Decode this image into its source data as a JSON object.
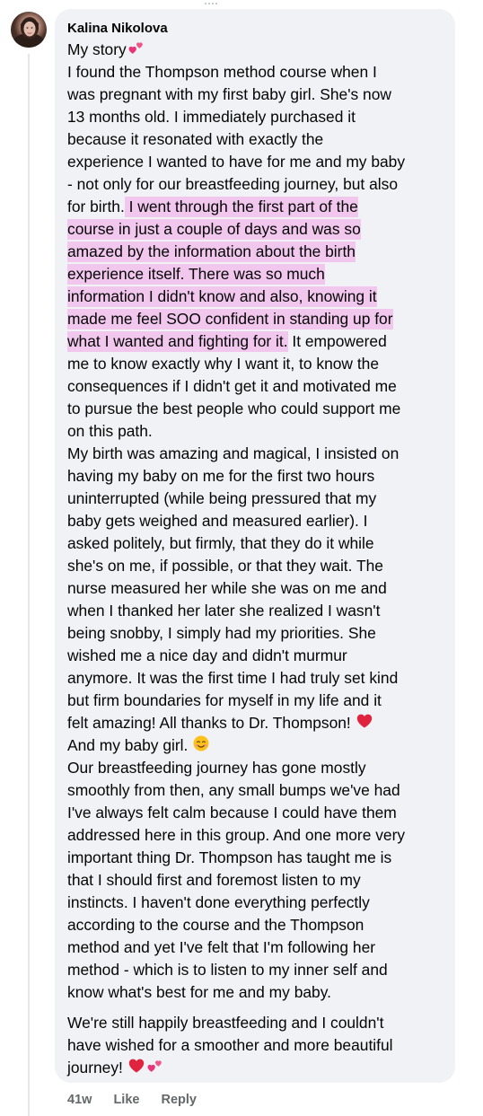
{
  "comment": {
    "author": "Kalina Nikolova",
    "paragraphs": [
      {
        "lines": [
          {
            "segments": [
              {
                "text": "My story"
              },
              {
                "emoji": "two-hearts-icon"
              }
            ]
          },
          {
            "segments": [
              {
                "text": "I found the Thompson method course when I"
              }
            ]
          },
          {
            "segments": [
              {
                "text": "was pregnant with my first baby girl. She's now"
              }
            ]
          },
          {
            "segments": [
              {
                "text": "13 months old. I immediately purchased it"
              }
            ]
          },
          {
            "segments": [
              {
                "text": "because it resonated with exactly the"
              }
            ]
          },
          {
            "segments": [
              {
                "text": "experience I wanted to have for me and my baby"
              }
            ]
          },
          {
            "segments": [
              {
                "text": "- not only for our breastfeeding journey, but also"
              }
            ]
          },
          {
            "segments": [
              {
                "text": "for birth."
              },
              {
                "text": " I went through the first part of the",
                "highlight": true
              }
            ]
          },
          {
            "segments": [
              {
                "text": "course in just a couple of days and was so",
                "highlight": true
              }
            ]
          },
          {
            "segments": [
              {
                "text": "amazed by the information about the birth",
                "highlight": true
              }
            ]
          },
          {
            "segments": [
              {
                "text": "experience itself. There was so much",
                "highlight": true
              }
            ]
          },
          {
            "segments": [
              {
                "text": "information I didn't know and also, knowing it",
                "highlight": true
              }
            ]
          },
          {
            "segments": [
              {
                "text": "made me feel SOO confident in standing up for",
                "highlight": true
              }
            ]
          },
          {
            "segments": [
              {
                "text": "what I wanted and fighting for it.",
                "highlight": true
              },
              {
                "text": " It empowered"
              }
            ]
          },
          {
            "segments": [
              {
                "text": "me to know exactly why I want it, to know the"
              }
            ]
          },
          {
            "segments": [
              {
                "text": "consequences if I didn't get it and motivated me"
              }
            ]
          },
          {
            "segments": [
              {
                "text": "to pursue the best people who could support me"
              }
            ]
          },
          {
            "segments": [
              {
                "text": "on this path."
              }
            ]
          },
          {
            "segments": [
              {
                "text": "My birth was amazing and magical, I insisted on"
              }
            ]
          },
          {
            "segments": [
              {
                "text": "having my baby on me for the first two hours"
              }
            ]
          },
          {
            "segments": [
              {
                "text": "uninterrupted (while being pressured that my"
              }
            ]
          },
          {
            "segments": [
              {
                "text": "baby gets weighed and measured earlier). I"
              }
            ]
          },
          {
            "segments": [
              {
                "text": "asked politely, but firmly, that they do it while"
              }
            ]
          },
          {
            "segments": [
              {
                "text": "she's on me, if possible, or that they wait. The"
              }
            ]
          },
          {
            "segments": [
              {
                "text": "nurse measured her while she was on me and"
              }
            ]
          },
          {
            "segments": [
              {
                "text": "when I thanked her later she realized I wasn't"
              }
            ]
          },
          {
            "segments": [
              {
                "text": "being snobby, I simply had my priorities. She"
              }
            ]
          },
          {
            "segments": [
              {
                "text": "wished me a nice day and didn't murmur"
              }
            ]
          },
          {
            "segments": [
              {
                "text": "anymore. It was the first time I had truly set kind"
              }
            ]
          },
          {
            "segments": [
              {
                "text": "but firm boundaries for myself in my life and it"
              }
            ]
          },
          {
            "segments": [
              {
                "text": "felt amazing! All thanks to Dr. Thompson! "
              },
              {
                "emoji": "red-heart-icon"
              }
            ]
          },
          {
            "segments": [
              {
                "text": "And my baby girl. "
              },
              {
                "emoji": "smiling-face-icon"
              }
            ]
          },
          {
            "segments": [
              {
                "text": "Our breastfeeding journey has gone mostly"
              }
            ]
          },
          {
            "segments": [
              {
                "text": "smoothly from then, any small bumps we've had"
              }
            ]
          },
          {
            "segments": [
              {
                "text": "I've always felt calm because I could have them"
              }
            ]
          },
          {
            "segments": [
              {
                "text": "addressed here in this group. And one more very"
              }
            ]
          },
          {
            "segments": [
              {
                "text": "important thing Dr. Thompson has taught me is"
              }
            ]
          },
          {
            "segments": [
              {
                "text": "that I should first and foremost listen to my"
              }
            ]
          },
          {
            "segments": [
              {
                "text": "instincts. I haven't done everything perfectly"
              }
            ]
          },
          {
            "segments": [
              {
                "text": "according to the course and the Thompson"
              }
            ]
          },
          {
            "segments": [
              {
                "text": "method and yet I've felt that I'm following her"
              }
            ]
          },
          {
            "segments": [
              {
                "text": "method - which is to listen to my inner self and"
              }
            ]
          },
          {
            "segments": [
              {
                "text": "know what's best for me and my baby."
              }
            ]
          }
        ]
      },
      {
        "lines": [
          {
            "segments": [
              {
                "text": "We're still happily breastfeeding and I couldn't"
              }
            ]
          },
          {
            "segments": [
              {
                "text": "have wished for a smoother and more beautiful"
              }
            ]
          },
          {
            "segments": [
              {
                "text": "journey! "
              },
              {
                "emoji": "red-heart-icon"
              },
              {
                "emoji": "two-hearts-icon"
              }
            ]
          }
        ]
      }
    ],
    "footer": {
      "time": "41w",
      "like_label": "Like",
      "reply_label": "Reply"
    }
  },
  "colors": {
    "bubble": "#f0f2f5",
    "text": "#050505",
    "meta": "#65676b",
    "highlight": "#f1c7ee",
    "heart": "#e0245e"
  }
}
